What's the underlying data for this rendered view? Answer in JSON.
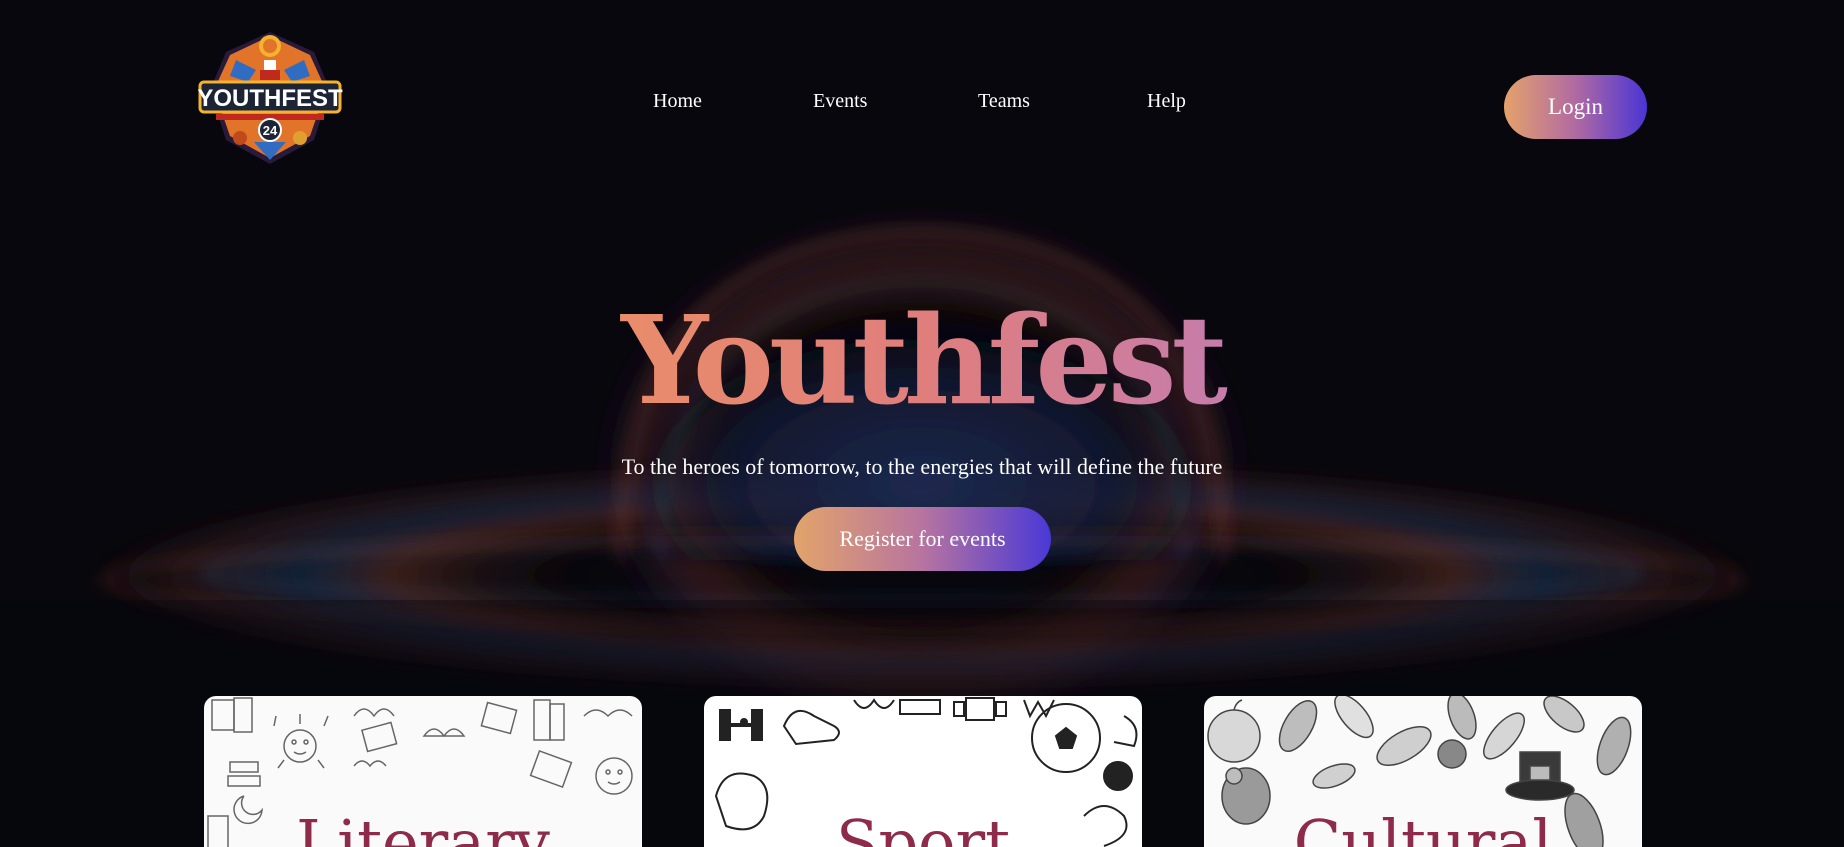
{
  "brand": {
    "logo_text": "YOUTHFEST",
    "logo_badge": "24",
    "icon": "youthfest-logo-icon"
  },
  "nav": {
    "items": [
      {
        "label": "Home"
      },
      {
        "label": "Events"
      },
      {
        "label": "Teams"
      },
      {
        "label": "Help"
      }
    ],
    "login_label": "Login"
  },
  "hero": {
    "title": "Youthfest",
    "subtitle": "To the heroes of tomorrow, to the energies that will define the future",
    "register_label": "Register for events"
  },
  "cards": [
    {
      "title": "Literary",
      "icon": "books-doodle-icon"
    },
    {
      "title": "Sport",
      "icon": "sports-doodle-icon"
    },
    {
      "title": "Cultural",
      "icon": "autumn-doodle-icon"
    }
  ],
  "colors": {
    "background": "#07070d",
    "gradient_start": "#f3ad5a",
    "gradient_mid": "#e07e7c",
    "gradient_end": "#7e86f5",
    "button_end": "#4a35d4",
    "card_title": "#8e2a4a"
  }
}
